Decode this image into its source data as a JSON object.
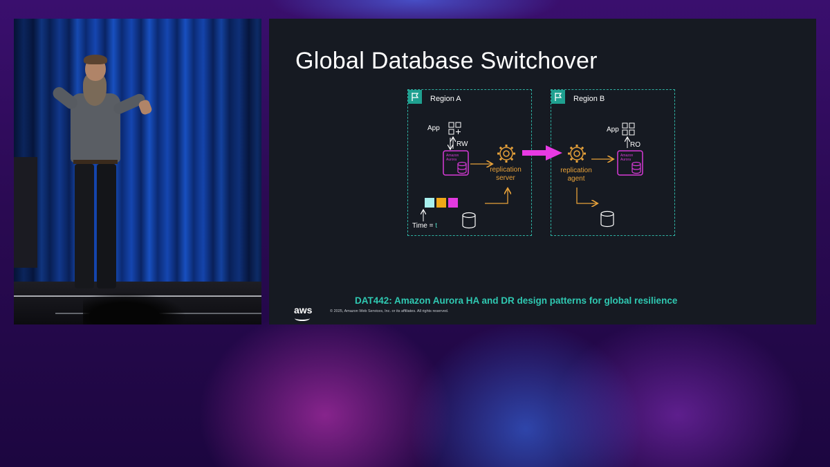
{
  "slide": {
    "title": "Global Database Switchover",
    "subtitle": "DAT442: Amazon Aurora HA and DR design patterns for global resilience",
    "copyright": "© 2025, Amazon Web Services, Inc. or its affiliates. All rights reserved.",
    "logo_text": "aws"
  },
  "diagram": {
    "region_a": {
      "label": "Region A",
      "app_label": "App",
      "access_label": "RW",
      "db_caption": "Amazon Aurora",
      "replication_label_line1": "replication",
      "replication_label_line2": "server",
      "time_label": "Time = ",
      "time_value": "t"
    },
    "region_b": {
      "label": "Region B",
      "app_label": "App",
      "access_label": "RO",
      "db_caption": "Amazon Aurora",
      "replication_label_line1": "replication",
      "replication_label_line2": "agent"
    },
    "queue_colors": [
      "#a8f0ee",
      "#f0a818",
      "#e33ae0"
    ],
    "colors": {
      "region_border": "#2fb3a4",
      "replication": "#e8a23a",
      "aurora": "#d83ad8",
      "switch_arrow": "#e83ae3",
      "subtitle": "#2fc9b2"
    }
  }
}
